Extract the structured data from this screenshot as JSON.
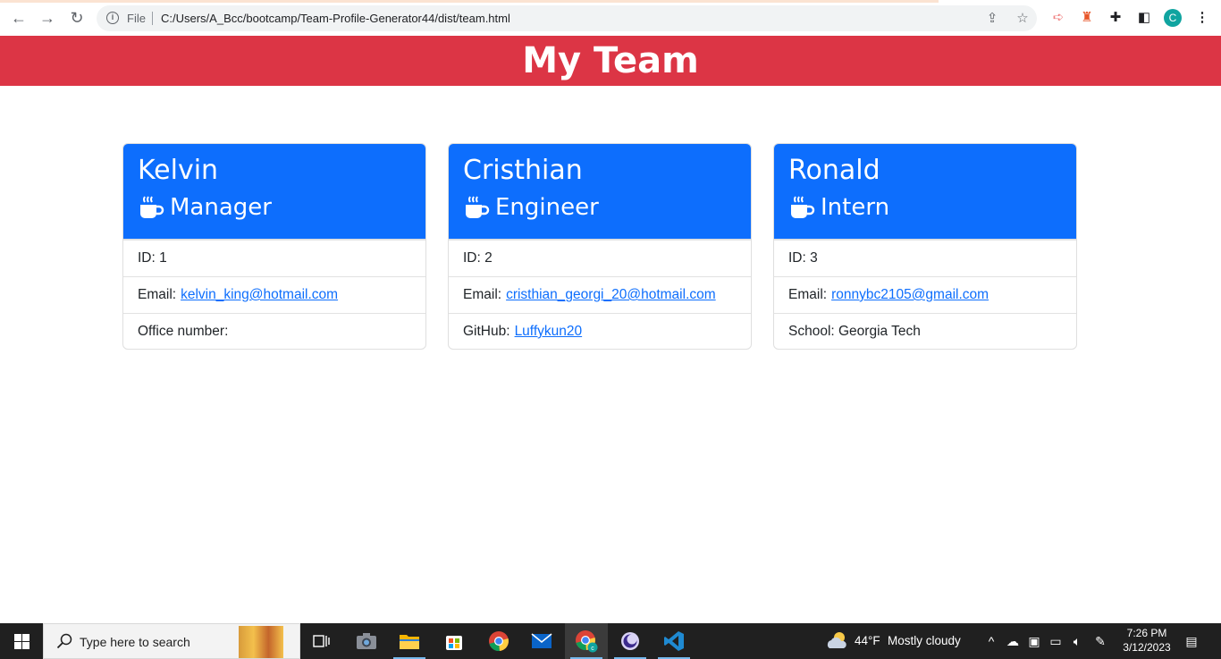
{
  "browser": {
    "file_label": "File",
    "url": "C:/Users/A_Bcc/bootcamp/Team-Profile-Generator44/dist/team.html",
    "profile_initial": "C"
  },
  "page": {
    "title": "My Team"
  },
  "team": [
    {
      "name": "Kelvin",
      "role": "Manager",
      "id_text": "ID: 1",
      "email_label": "Email:",
      "email": "kelvin_king@hotmail.com",
      "extra_label": "Office number:",
      "extra_value": ""
    },
    {
      "name": "Cristhian",
      "role": "Engineer",
      "id_text": "ID: 2",
      "email_label": "Email:",
      "email": "cristhian_georgi_20@hotmail.com",
      "extra_label": "GitHub:",
      "extra_value": "Luffykun20"
    },
    {
      "name": "Ronald",
      "role": "Intern",
      "id_text": "ID: 3",
      "email_label": "Email:",
      "email": "ronnybc2105@gmail.com",
      "extra_label": "School: Georgia Tech",
      "extra_value": ""
    }
  ],
  "taskbar": {
    "search_placeholder": "Type here to search",
    "weather_temp": "44°F",
    "weather_text": "Mostly cloudy",
    "time": "7:26 PM",
    "date": "3/12/2023"
  },
  "colors": {
    "header_bg": "#dc3545",
    "card_head_bg": "#0d6efd",
    "link": "#0d6efd"
  }
}
